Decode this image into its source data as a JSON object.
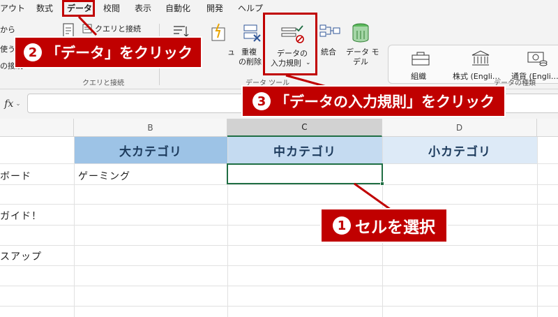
{
  "menubar": {
    "items": [
      {
        "label": "アウト"
      },
      {
        "label": "数式"
      },
      {
        "label": "データ"
      },
      {
        "label": "校閲"
      },
      {
        "label": "表示"
      },
      {
        "label": "自動化"
      },
      {
        "label": "開発"
      },
      {
        "label": "ヘルプ"
      }
    ],
    "active_index": 2
  },
  "ribbon": {
    "get_data": {
      "line1": "から",
      "line2": "使う",
      "line3": "の接続"
    },
    "queries": {
      "label": "クエリと接続"
    },
    "queries_group_label": "クエリと接続",
    "remove_duplicates": {
      "line1": "重複",
      "line2": "の削除"
    },
    "data_validation": {
      "line1": "データの",
      "line2": "入力規則"
    },
    "consolidate": {
      "label": "統合"
    },
    "data_model": {
      "line1": "データ モ",
      "line2": "デル"
    },
    "flash_fill_partial": "ュ",
    "data_tools_group_label": "データ ツール",
    "datatypes": {
      "items": [
        {
          "label": "組織"
        },
        {
          "label": "株式 (Engli…"
        },
        {
          "label": "通貨 (Engli…"
        }
      ],
      "group_label": "データの種類"
    }
  },
  "formula_bar": {
    "fx": "fx",
    "value": ""
  },
  "grid": {
    "columns": [
      {
        "letter": "B"
      },
      {
        "letter": "C"
      },
      {
        "letter": "D"
      }
    ],
    "headers": {
      "b": "大カテゴリ",
      "c": "中カテゴリ",
      "d": "小カテゴリ"
    },
    "rows": [
      {
        "a": "ボード",
        "b": "ゲーミング"
      },
      {
        "a": "ガイド！"
      },
      {
        "a": "スアップ"
      }
    ]
  },
  "annotations": {
    "step1": {
      "num": "1",
      "text": "セルを選択"
    },
    "step2": {
      "num": "2",
      "text": "「データ」をクリック"
    },
    "step3": {
      "num": "3",
      "text": "「データの入力規則」をクリック"
    }
  },
  "colors": {
    "accent_red": "#c00000",
    "excel_green": "#1f6e43"
  }
}
